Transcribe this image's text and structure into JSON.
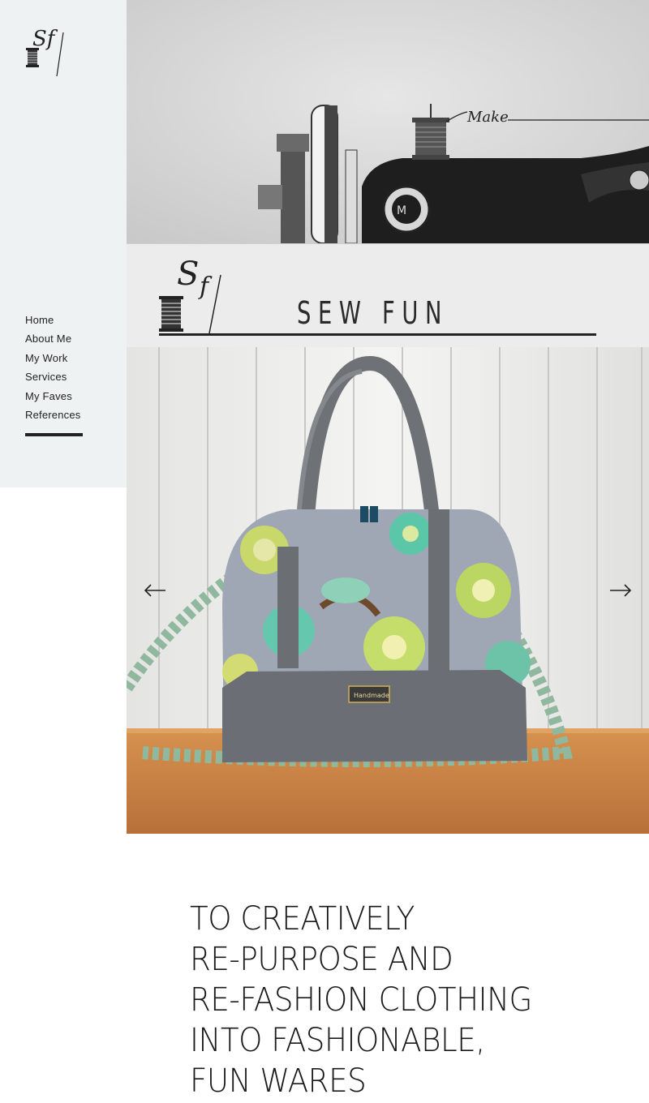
{
  "brand": {
    "logo_mark": "Sf",
    "name": "SEW FUN",
    "machine_script": "Make"
  },
  "nav": {
    "items": [
      {
        "label": "Home"
      },
      {
        "label": "About Me"
      },
      {
        "label": "My Work"
      },
      {
        "label": "Services"
      },
      {
        "label": "My Faves"
      },
      {
        "label": "References"
      }
    ]
  },
  "slider": {
    "prev_icon": "arrow-left-icon",
    "next_icon": "arrow-right-icon",
    "bag_label": "Handmade"
  },
  "tagline": {
    "lines": [
      "TO CREATIVELY",
      "RE-PURPOSE AND",
      "RE-FASHION CLOTHING",
      "INTO FASHIONABLE,",
      "FUN WARES"
    ]
  },
  "colors": {
    "sidebar_bg": "#eff2f3",
    "text": "#222222",
    "banner_bg": "#ececec"
  }
}
